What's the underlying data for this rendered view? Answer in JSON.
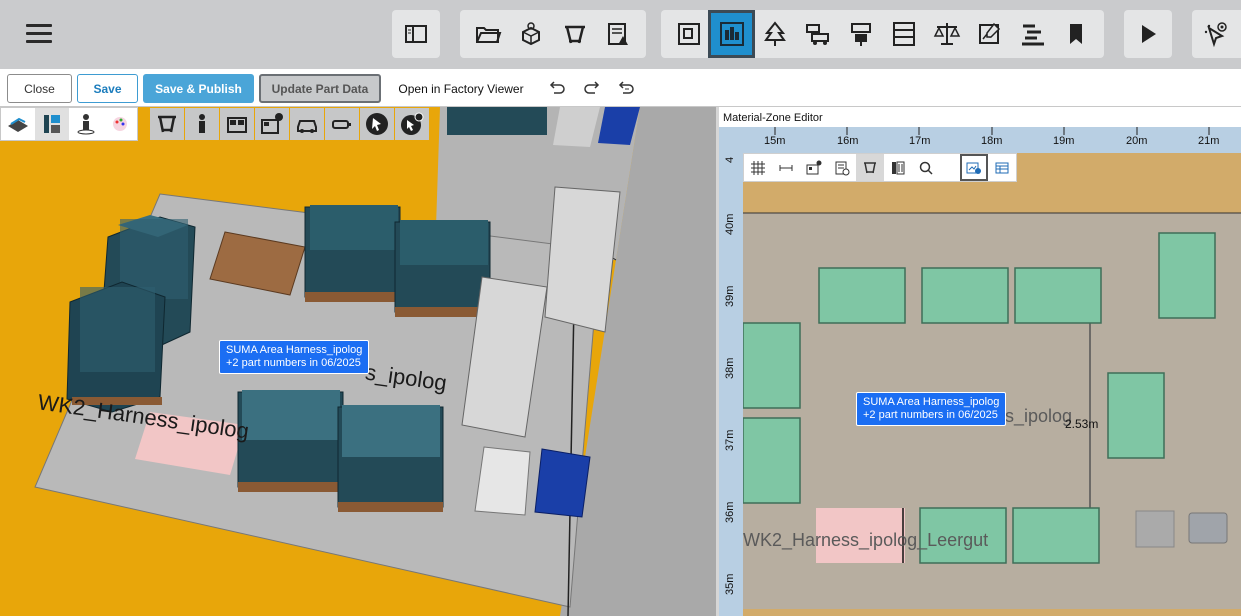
{
  "actionbar": {
    "close_label": "Close",
    "save_label": "Save",
    "publish_label": "Save & Publish",
    "update_label": "Update Part Data",
    "viewer_label": "Open in Factory Viewer"
  },
  "scene": {
    "zone_label_left": "WK2_Harness_ipolog",
    "zone_label_right": "s_ipolog",
    "tooltip_line1": "SUMA Area Harness_ipolog",
    "tooltip_line2": "+2 part numbers in 06/2025"
  },
  "editor": {
    "title": "Material-Zone Editor",
    "ruler_x": [
      "15m",
      "16m",
      "17m",
      "18m",
      "19m",
      "20m",
      "21m"
    ],
    "ruler_y": [
      "4",
      "40m",
      "39m",
      "38m",
      "37m",
      "36m",
      "35m"
    ],
    "zone_label_bottom": "WK2_Harness_ipolog_Leergut",
    "zone_label_mid": "s_ipolog",
    "dimension": "2.53m",
    "tooltip_line1": "SUMA Area Harness_ipolog",
    "tooltip_line2": "+2 part numbers in 06/2025"
  },
  "colors": {
    "accent": "#1f8fce",
    "floor_orange": "#e8a60a",
    "zone_green": "#7fc6a4",
    "zone_pink": "#f2c6c6",
    "tooltip_blue": "#1b6ef3"
  },
  "icons": {
    "top_toolbar": [
      "menu-icon",
      "panel-toggle-icon",
      "folder-open-icon",
      "part-box-icon",
      "workstation-icon",
      "report-warning-icon",
      "layout-frame-icon",
      "material-zone-icon",
      "tree-icon",
      "vehicles-icon",
      "machine-icon",
      "shelf-icon",
      "scale-icon",
      "edit-chart-icon",
      "gantt-icon",
      "bookmark-icon",
      "play-icon",
      "cursor-view-icon"
    ],
    "mini_toolbar": [
      "layers-icon",
      "zones-icon",
      "person-location-icon",
      "palette-icon",
      "workstation-icon",
      "person-icon",
      "rack-icon",
      "rack-text-icon",
      "vehicle-icon",
      "battery-icon",
      "select-cursor-icon",
      "text-cursor-icon"
    ],
    "editor_toolbar": [
      "grid-icon",
      "distance-icon",
      "rack-text-icon",
      "inspect-icon",
      "workstation-icon",
      "zones-icon",
      "search-icon",
      "export-icon",
      "table-icon"
    ]
  }
}
